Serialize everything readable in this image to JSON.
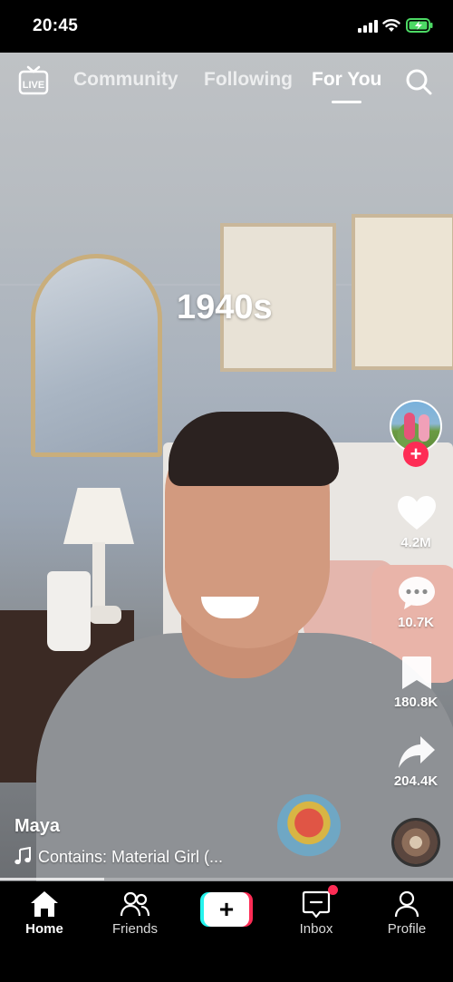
{
  "status_bar": {
    "time": "20:45"
  },
  "top_nav": {
    "live_icon": "live-icon",
    "tabs": [
      {
        "label": "Community",
        "active": false
      },
      {
        "label": "Following",
        "active": false
      },
      {
        "label": "For You",
        "active": true
      }
    ],
    "search_icon": "search-icon"
  },
  "video": {
    "overlay_text": "1940s",
    "author": "Maya",
    "sound": "Contains: Material Girl (...",
    "progress_fraction": 0.23
  },
  "actions": {
    "likes": "4.2M",
    "comments": "10.7K",
    "bookmarks": "180.8K",
    "shares": "204.4K"
  },
  "bottom_nav": {
    "items": [
      {
        "label": "Home",
        "icon": "home-icon",
        "active": true
      },
      {
        "label": "Friends",
        "icon": "friends-icon",
        "active": false
      },
      {
        "label": "",
        "icon": "create-plus-icon",
        "active": false
      },
      {
        "label": "Inbox",
        "icon": "inbox-icon",
        "active": false,
        "has_notification": true
      },
      {
        "label": "Profile",
        "icon": "profile-icon",
        "active": false
      }
    ]
  },
  "colors": {
    "accent_red": "#fe2c55",
    "accent_cyan": "#25f4ee",
    "battery_green": "#4cd964"
  }
}
